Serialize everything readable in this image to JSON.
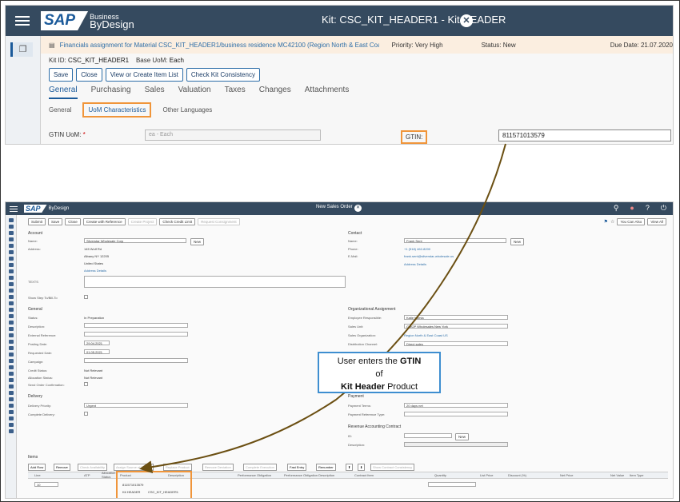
{
  "top": {
    "shell_title": "Kit: CSC_KIT_HEADER1 - Kit HEADER",
    "brand_sap": "SAP",
    "brand_business": "Business",
    "brand_bydesign": "ByDesign",
    "task_text": "Financials assignment for Material CSC_KIT_HEADER1/business residence MC42100 (Region North & East Coa...",
    "priority": "Priority: Very High",
    "status": "Status: New",
    "due": "Due Date: 21.07.2020",
    "kit_id_label": "Kit ID:",
    "kit_id_value": "CSC_KIT_HEADER1",
    "base_uom_label": "Base UoM:",
    "base_uom_value": "Each",
    "buttons": [
      "Save",
      "Close",
      "View or Create Item List",
      "Check Kit Consistency"
    ],
    "tabs": [
      "General",
      "Purchasing",
      "Sales",
      "Valuation",
      "Taxes",
      "Changes",
      "Attachments"
    ],
    "subtabs": [
      "General",
      "UoM Characteristics",
      "Other Languages"
    ],
    "gtin_uom_label": "GTIN UoM:",
    "gtin_uom_value": "ea - Each",
    "gtin_label": "GTIN:",
    "gtin_value": "811571013579"
  },
  "bottom": {
    "shell_title": "New Sales Order",
    "brand_sap": "SAP",
    "brand_bydesign": "ByDesign",
    "buttons": [
      "Submit",
      "Save",
      "Close",
      "Create with Reference",
      "Create Project",
      "Check Credit Limit",
      "Request Consignment"
    ],
    "right_buttons": [
      "You Can Also",
      "View All"
    ],
    "account_section": "Account",
    "name_label": "Name:",
    "name_value": "Silverstar Wholesale Corp",
    "new_label": "New",
    "address_label": "Address:",
    "address_lines": [
      "145 Wolf Rd",
      "Albany NY 12205",
      "United States"
    ],
    "address_details": "Address Details",
    "contact_section": "Contact",
    "contact_name": "Frank Sent",
    "phone_label": "Phone:",
    "phone_value": "+1 (518) 462-8200",
    "email_label": "E-Mail:",
    "email_value": "frank.sent@silverstar-wholesale.us",
    "texts_label": "TEXTS",
    "show_step_label": "Show Step To/Bill-To",
    "general_section": "General",
    "status_label": "Status:",
    "status_value": "In Preparation",
    "description_label": "Description:",
    "ext_ref_label": "External Reference:",
    "posting_date_label": "Posting Date:",
    "posting_date_value": "29.04.2021",
    "requested_date_label": "Requested Date:",
    "requested_date_value": "01.05.2021",
    "campaign_label": "Campaign:",
    "credit_status_label": "Credit Status:",
    "credit_status_value": "Not Relevant",
    "alloc_status_label": "Allocation Status:",
    "alloc_status_value": "Not Relevant",
    "send_confirm_label": "Send Order Confirmation:",
    "org_section": "Organizational Assignment",
    "emp_resp_label": "Employee Responsible:",
    "emp_resp_value": "Katie Kumla",
    "sales_unit_label": "Sales Unit:",
    "sales_unit_value": "GMOP Wholesales New York",
    "sales_org_label": "Sales Organization:",
    "sales_org_value": "Region North & East Coast US",
    "dist_channel_label": "Distribution Channel:",
    "dist_channel_value": "Direct sales",
    "delivery_section": "Delivery",
    "del_priority_label": "Delivery Priority:",
    "del_priority_value": "Urgent",
    "complete_del_label": "Complete Delivery:",
    "payment_section": "Payment",
    "pay_terms_label": "Payment Terms:",
    "pay_terms_value": "20 days net",
    "pay_ref_label": "Payment Reference Type:",
    "rev_section": "Revenue Accounting Contract",
    "id_label": "ID:",
    "desc2_label": "Description:",
    "items_section": "Items",
    "item_buttons": [
      "Add Row",
      "Remove",
      "Check Availability",
      "Assign Source of Supply",
      "Replace Product",
      "Remove Deviation",
      "Complete Execution",
      "Fast Entry",
      "Renumber"
    ],
    "item_buttons_right": [
      "Show Contract Consistency"
    ],
    "col_headers": [
      "Line",
      "ATP",
      "Allocation Status",
      "Product",
      "Description",
      "Performance Obligation",
      "Performance Obligation Description",
      "Contract Item",
      "Quantity",
      "List Price",
      "Discount (%)",
      "Net Price",
      "Net Value",
      "Item Type"
    ],
    "row_line": "10",
    "row_product": "811571013579",
    "row_product_name": "Kit HEADER",
    "row_description": "CSC_KIT_HEADER1"
  },
  "callout": {
    "line1_pre": "User enters the ",
    "line1_bold": "GTIN",
    "line2": "of",
    "line3_bold": "Kit Header",
    "line3_post": " Product"
  },
  "colors": {
    "shell": "#354a5f",
    "highlight": "#f0953a",
    "arrow": "#6b4f12",
    "callout_border": "#3e8ed0"
  }
}
